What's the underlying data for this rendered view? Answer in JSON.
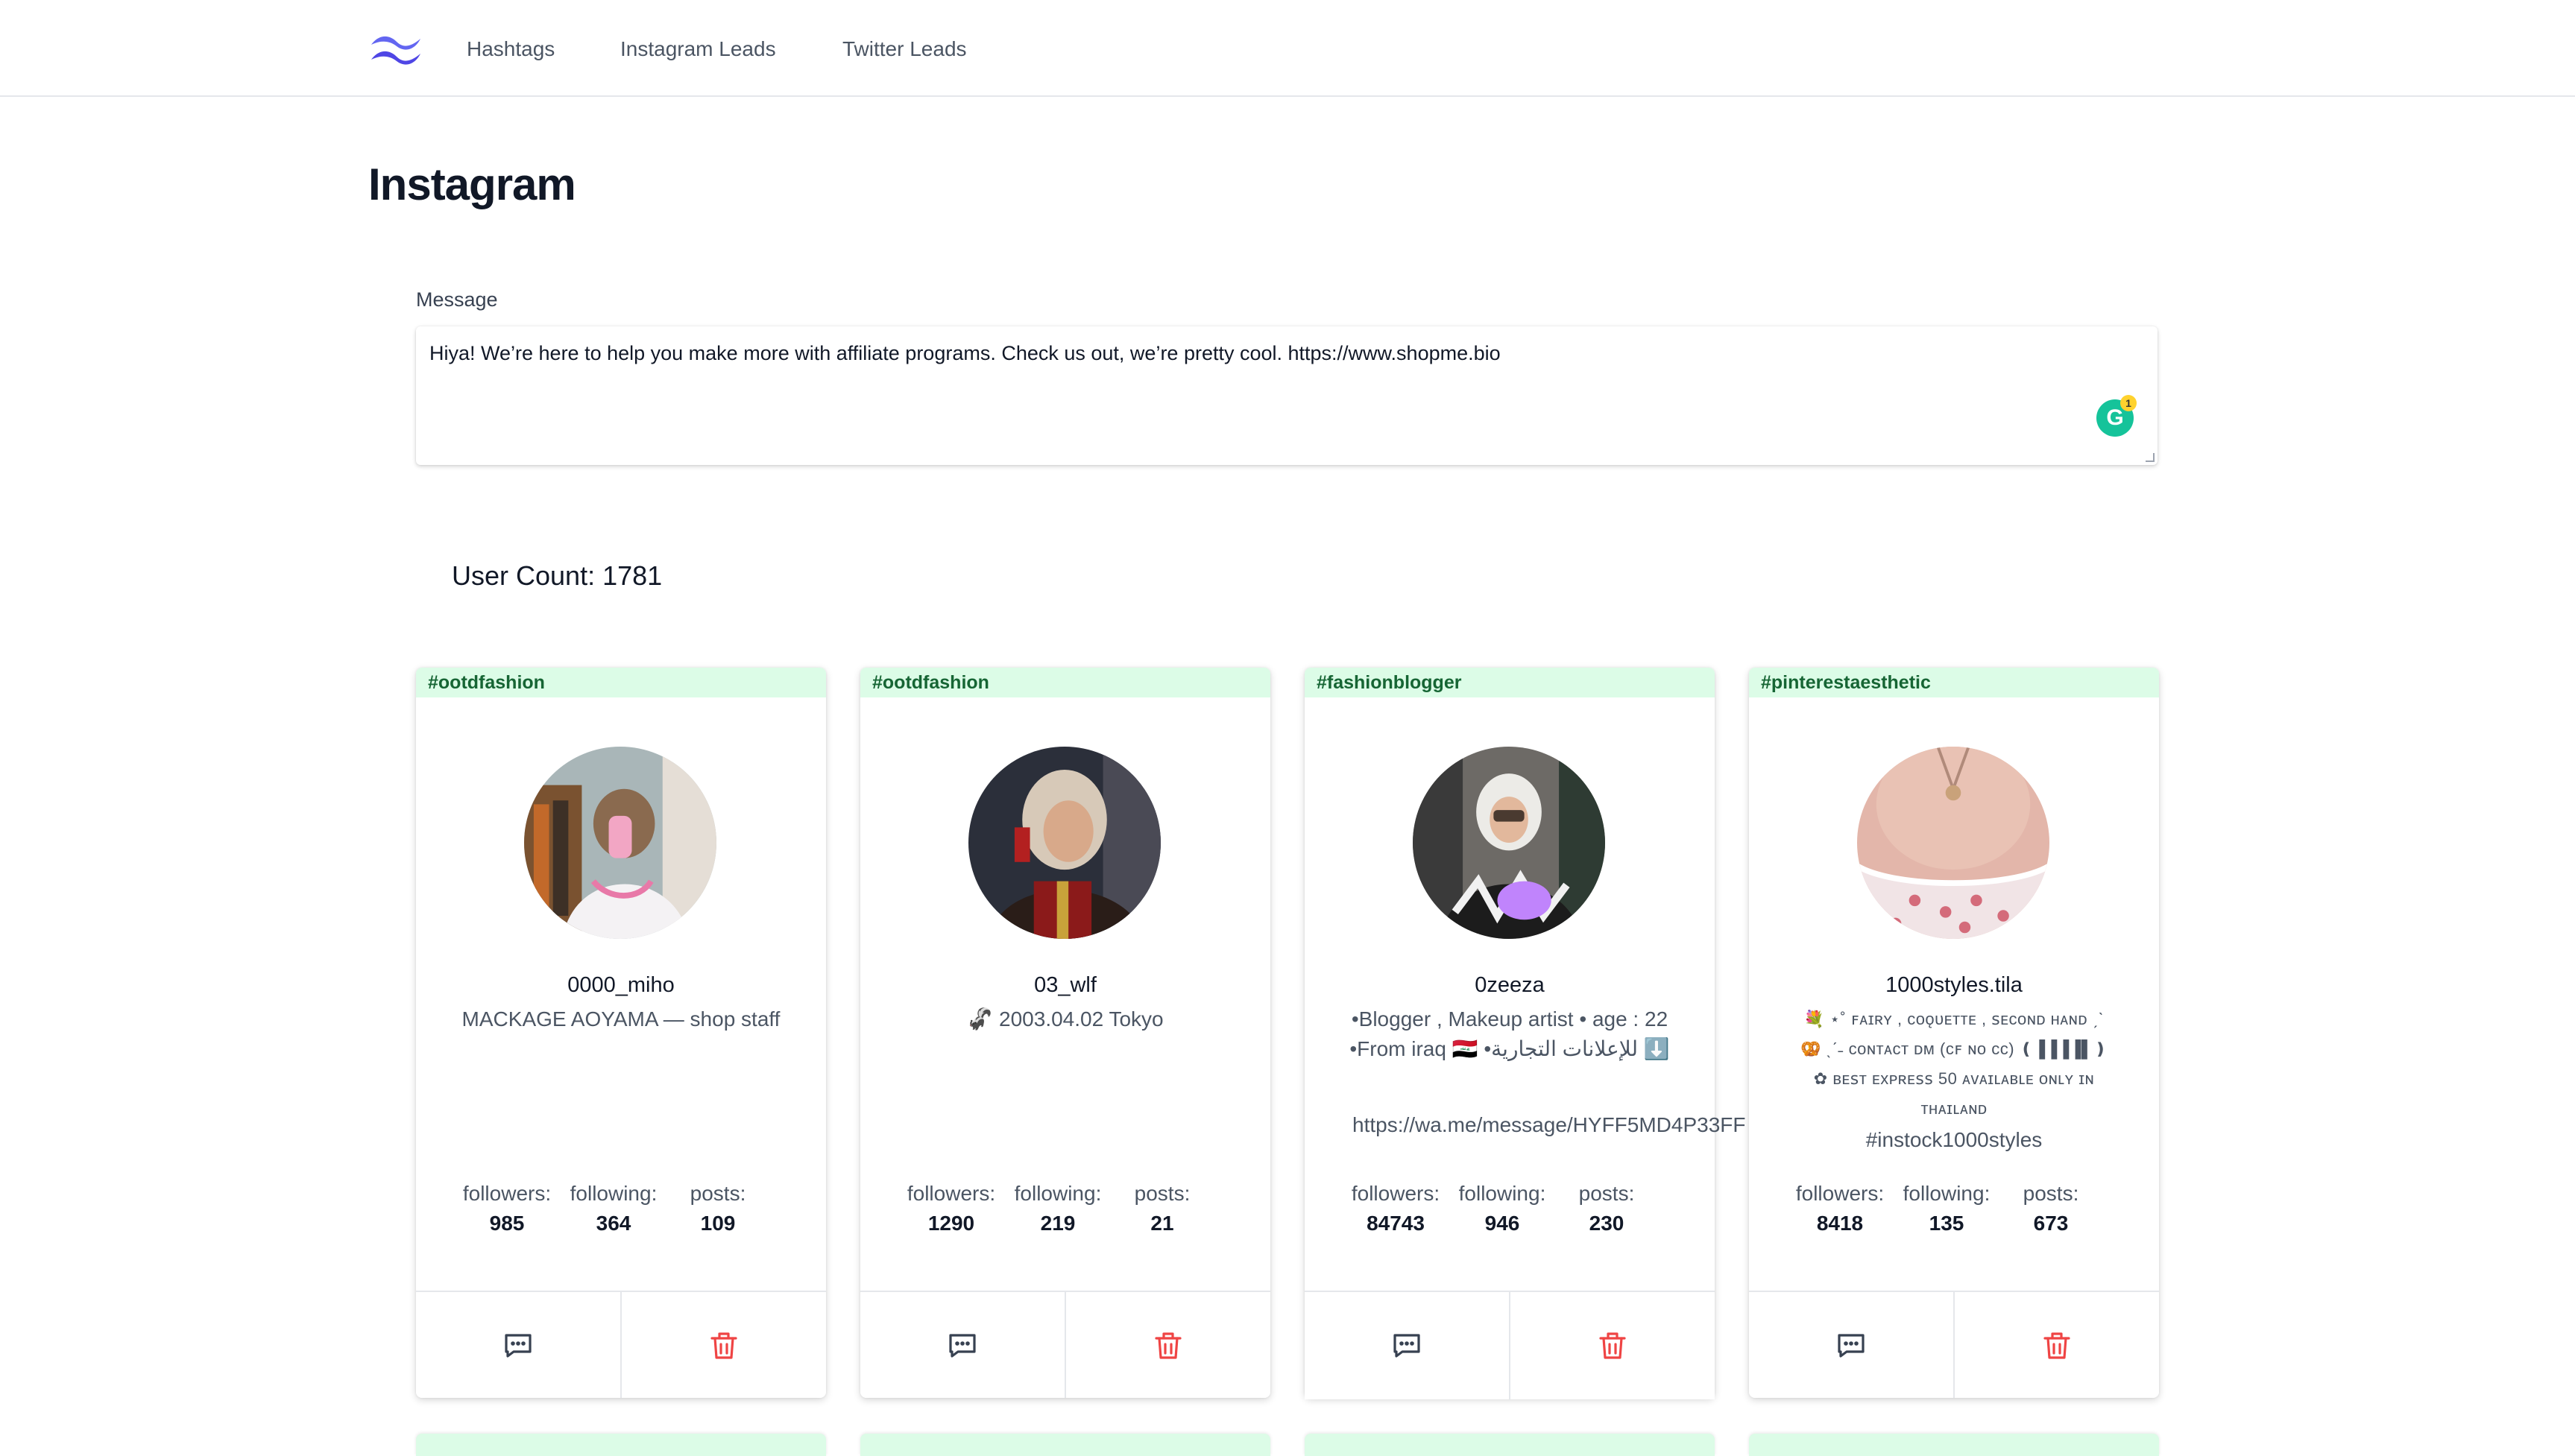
{
  "nav": {
    "links": [
      "Hashtags",
      "Instagram Leads",
      "Twitter Leads"
    ],
    "brand_color": "#6366f1"
  },
  "page": {
    "title": "Instagram"
  },
  "message": {
    "label": "Message",
    "value": "Hiya! We’re here to help you make more with affiliate programs. Check us out, we’re pretty cool. https://www.shopme.bio",
    "grammarly_count": "1"
  },
  "user_count": {
    "text": "User Count: 1781"
  },
  "stat_labels": {
    "followers": "followers:",
    "following": "following:",
    "posts": "posts:"
  },
  "cards": [
    {
      "hashtag": "#ootdfashion",
      "username": "0000_miho",
      "bio": "MACKAGE AOYAMA — shop staff",
      "link": "",
      "followers": "985",
      "following": "364",
      "posts": "109"
    },
    {
      "hashtag": "#ootdfashion",
      "username": "03_wlf",
      "bio": "🦨 2003.04.02 Tokyo",
      "link": "",
      "followers": "1290",
      "following": "219",
      "posts": "21"
    },
    {
      "hashtag": "#fashionblogger",
      "username": "0zeeza",
      "bio": "•Blogger , Makeup artist • age : 22 •From iraq 🇮🇶 •للإعلانات التجارية ⬇️",
      "link": "https://wa.me/message/HYFF5MD4P33FF",
      "followers": "84743",
      "following": "946",
      "posts": "230"
    },
    {
      "hashtag": "#pinterestaesthetic",
      "username": "1000styles.tila",
      "bio": "💐 ⋆˚ ꜰᴀɪʀʏ , ᴄᴏǫᴜᴇᴛᴛᴇ , ꜱᴇᴄᴏɴᴅ ʜᴀɴᴅ ˏˋ🥨 ˎˊ˗ ᴄᴏɴᴛᴀᴄᴛ ᴅᴍ (ᴄꜰ ɴᴏ ᴄᴄ) ❪▐▐▐▐▌❫ ✿ ʙᴇꜱᴛ ᴇxᴘʀᴇꜱꜱ 50 ᴀᴠᴀɪʟᴀʙʟᴇ ᴏɴʟʏ ɪɴ ᴛʜᴀɪʟᴀɴᴅ",
      "bio_extra": "#instock1000styles",
      "link": "",
      "followers": "8418",
      "following": "135",
      "posts": "673"
    }
  ],
  "colors": {
    "tag_bg": "#dcfce7",
    "tag_text": "#166534",
    "delete_red": "#ef4444",
    "message_icon": "#374151"
  }
}
